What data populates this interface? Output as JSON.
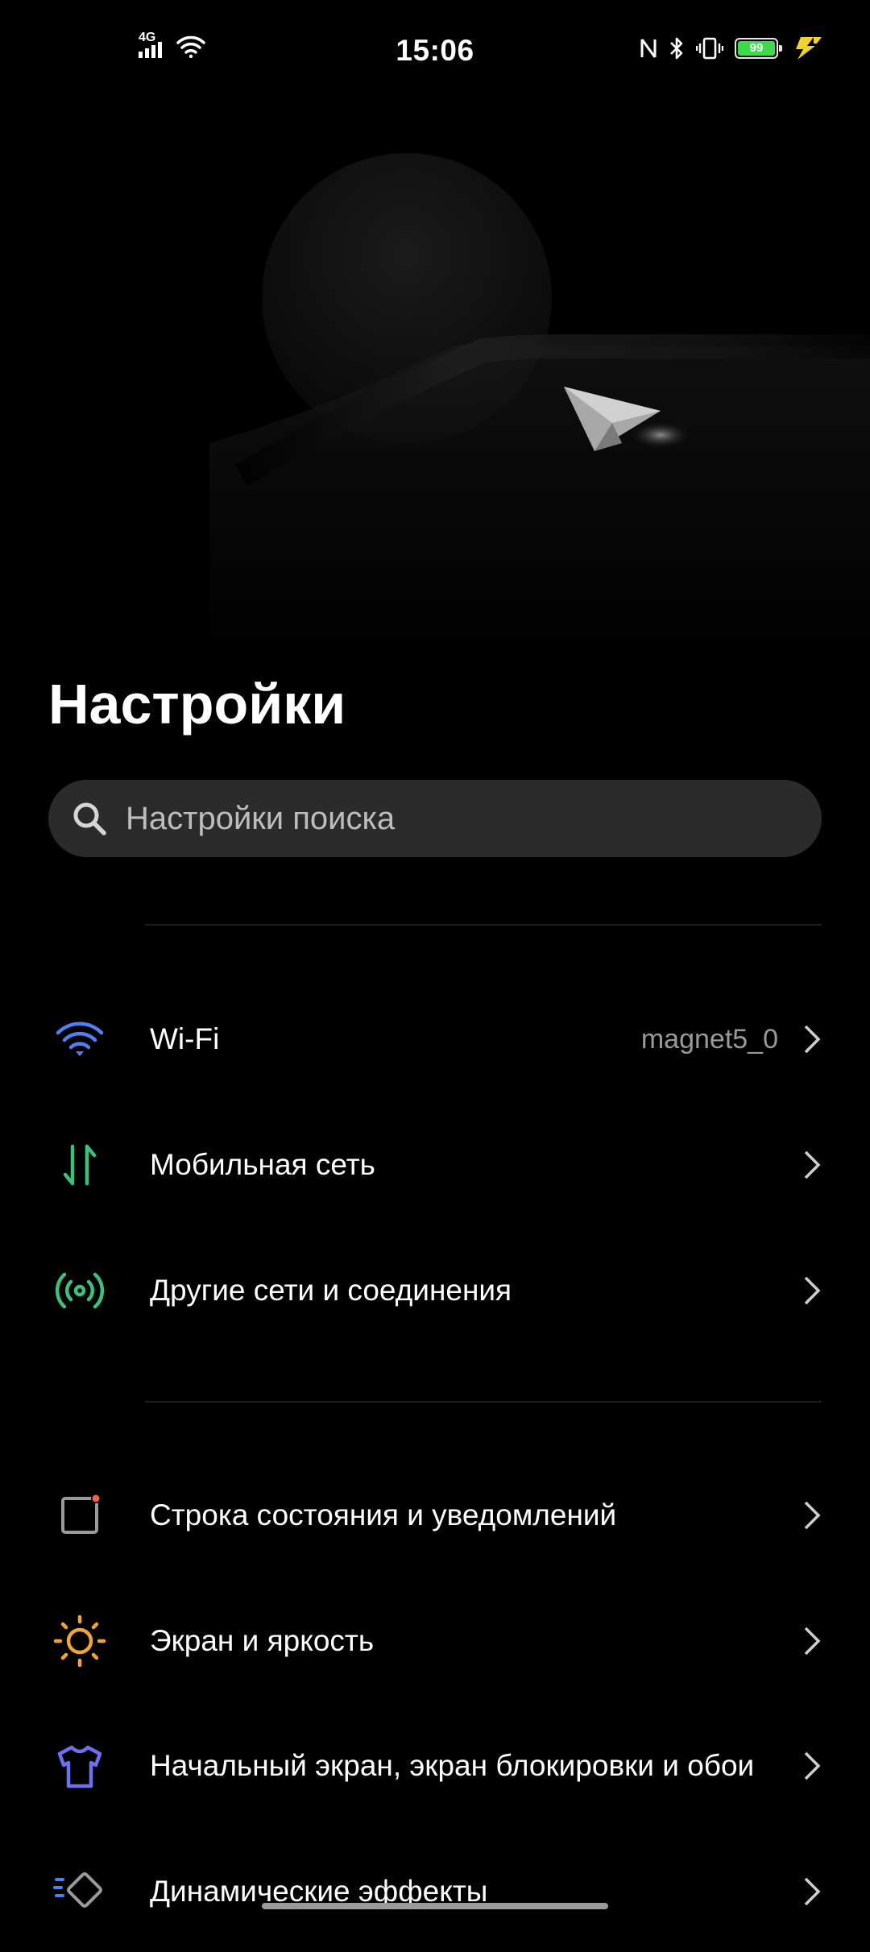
{
  "status_bar": {
    "network_type": "4G",
    "time": "15:06",
    "battery_level": "99",
    "battery_percent": 99,
    "icons": [
      "signal-icon",
      "wifi-icon",
      "nfc-icon",
      "bluetooth-icon",
      "vibrate-icon",
      "battery-icon",
      "charging-icon"
    ]
  },
  "page": {
    "title": "Настройки"
  },
  "search": {
    "placeholder": "Настройки поиска"
  },
  "groups": [
    {
      "items": [
        {
          "label": "Wi-Fi",
          "value": "magnet5_0",
          "icon": "wifi-icon",
          "color": "#4f7ff0"
        },
        {
          "label": "Мобильная сеть",
          "icon": "mobile-data-icon",
          "color": "#3fbf7f"
        },
        {
          "label": "Другие сети и соединения",
          "icon": "connections-icon",
          "color": "#3fbf7f"
        }
      ]
    },
    {
      "items": [
        {
          "label": "Строка состояния и уведомлений",
          "icon": "notification-icon",
          "color": "#9a9a9a",
          "accent": "#f0614f"
        },
        {
          "label": "Экран и яркость",
          "icon": "brightness-icon",
          "color": "#f0a33a"
        },
        {
          "label": "Начальный экран, экран блокировки и обои",
          "icon": "theme-shirt-icon",
          "color": "#6f6ff0"
        },
        {
          "label": "Динамические эффекты",
          "icon": "dynamic-effects-icon",
          "color": "#4f7ff0"
        }
      ]
    }
  ]
}
